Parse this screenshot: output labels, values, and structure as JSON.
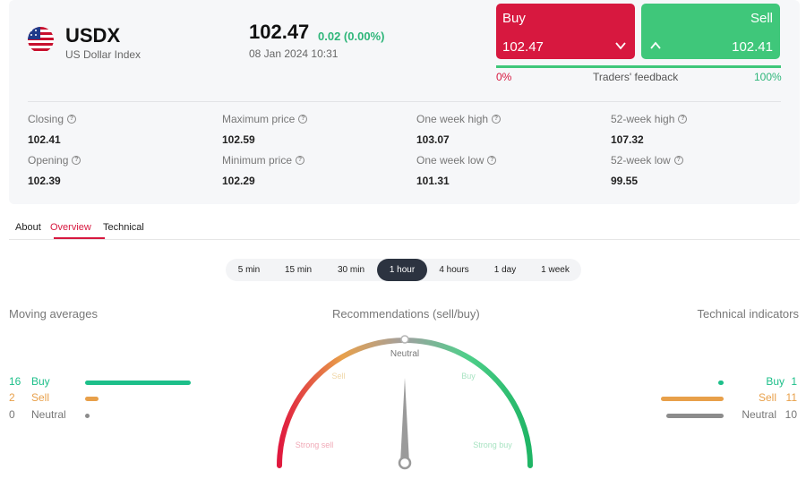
{
  "instrument": {
    "symbol": "USDX",
    "name": "US Dollar Index",
    "price": "102.47",
    "change": "0.02 (0.00%)",
    "datetime": "08 Jan 2024 10:31"
  },
  "trade": {
    "buy_label": "Buy",
    "buy_price": "102.47",
    "sell_label": "Sell",
    "sell_price": "102.41"
  },
  "feedback": {
    "left_pct": "0%",
    "label": "Traders' feedback",
    "right_pct": "100%",
    "buy_fraction": 0.0
  },
  "stats": [
    {
      "label": "Closing",
      "value": "102.41"
    },
    {
      "label": "Maximum price",
      "value": "102.59"
    },
    {
      "label": "One week high",
      "value": "103.07"
    },
    {
      "label": "52-week high",
      "value": "107.32"
    },
    {
      "label": "Opening",
      "value": "102.39"
    },
    {
      "label": "Minimum price",
      "value": "102.29"
    },
    {
      "label": "One week low",
      "value": "101.31"
    },
    {
      "label": "52-week low",
      "value": "99.55"
    }
  ],
  "tabs": [
    "About",
    "Overview",
    "Technical"
  ],
  "active_tab": "Overview",
  "timeframes": [
    "5 min",
    "15 min",
    "30 min",
    "1 hour",
    "4 hours",
    "1 day",
    "1 week"
  ],
  "active_timeframe": "1 hour",
  "moving_averages": {
    "title": "Moving averages",
    "rows": [
      {
        "count": "16",
        "label": "Buy",
        "value": 16
      },
      {
        "count": "2",
        "label": "Sell",
        "value": 2
      },
      {
        "count": "0",
        "label": "Neutral",
        "value": 0
      }
    ]
  },
  "recommendations": {
    "title": "Recommendations (sell/buy)",
    "labels": {
      "neutral": "Neutral",
      "sell": "Sell",
      "buy": "Buy",
      "strong_sell": "Strong sell",
      "strong_buy": "Strong buy"
    },
    "needle_fraction": 0.5
  },
  "technical_indicators": {
    "title": "Technical indicators",
    "rows": [
      {
        "count": "1",
        "label": "Buy",
        "value": 1
      },
      {
        "count": "11",
        "label": "Sell",
        "value": 11
      },
      {
        "count": "10",
        "label": "Neutral",
        "value": 10
      }
    ]
  },
  "colors": {
    "buy": "#1dbf8a",
    "sell": "#e8a04a",
    "neutral": "#8c8c8c",
    "red": "#d7183f",
    "green": "#3fc77a"
  }
}
